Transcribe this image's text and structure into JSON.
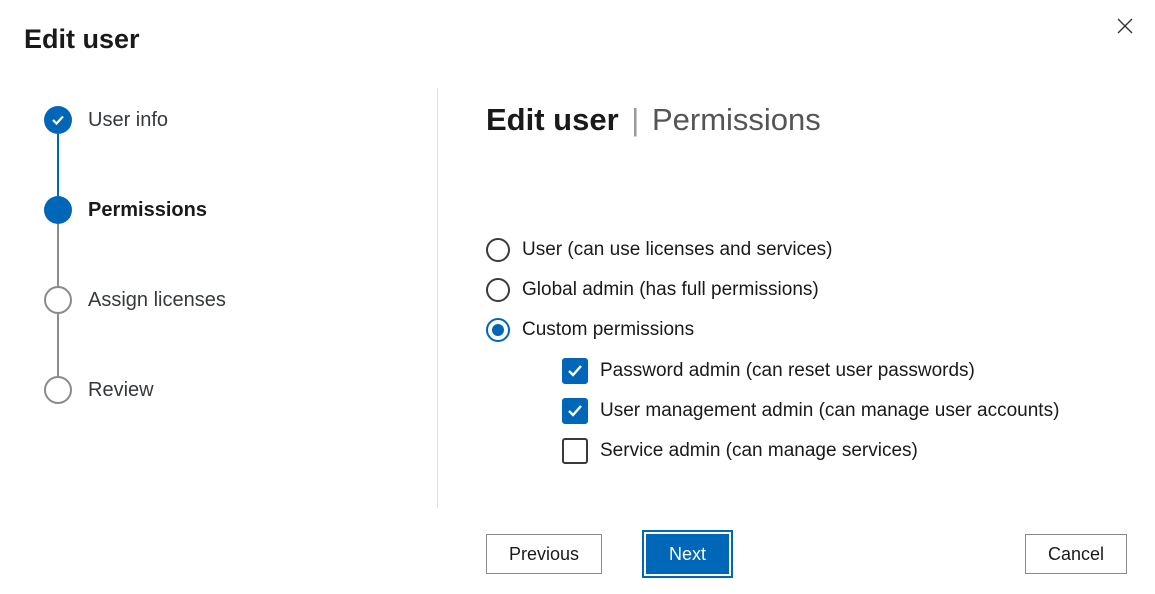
{
  "header": {
    "title": "Edit user"
  },
  "stepper": {
    "items": [
      {
        "label": "User info",
        "state": "done"
      },
      {
        "label": "Permissions",
        "state": "current"
      },
      {
        "label": "Assign licenses",
        "state": "pending"
      },
      {
        "label": "Review",
        "state": "pending"
      }
    ]
  },
  "main": {
    "title_bold": "Edit user",
    "title_sep": "|",
    "title_rest": "Permissions",
    "radios": [
      {
        "label": "User (can use licenses and services)",
        "selected": false
      },
      {
        "label": "Global admin (has full permissions)",
        "selected": false
      },
      {
        "label": "Custom permissions",
        "selected": true
      }
    ],
    "checkboxes": [
      {
        "label": "Password admin (can reset user passwords)",
        "checked": true
      },
      {
        "label": "User management admin (can manage user accounts)",
        "checked": true
      },
      {
        "label": "Service admin (can manage services)",
        "checked": false
      }
    ]
  },
  "footer": {
    "previous": "Previous",
    "next": "Next",
    "cancel": "Cancel"
  }
}
